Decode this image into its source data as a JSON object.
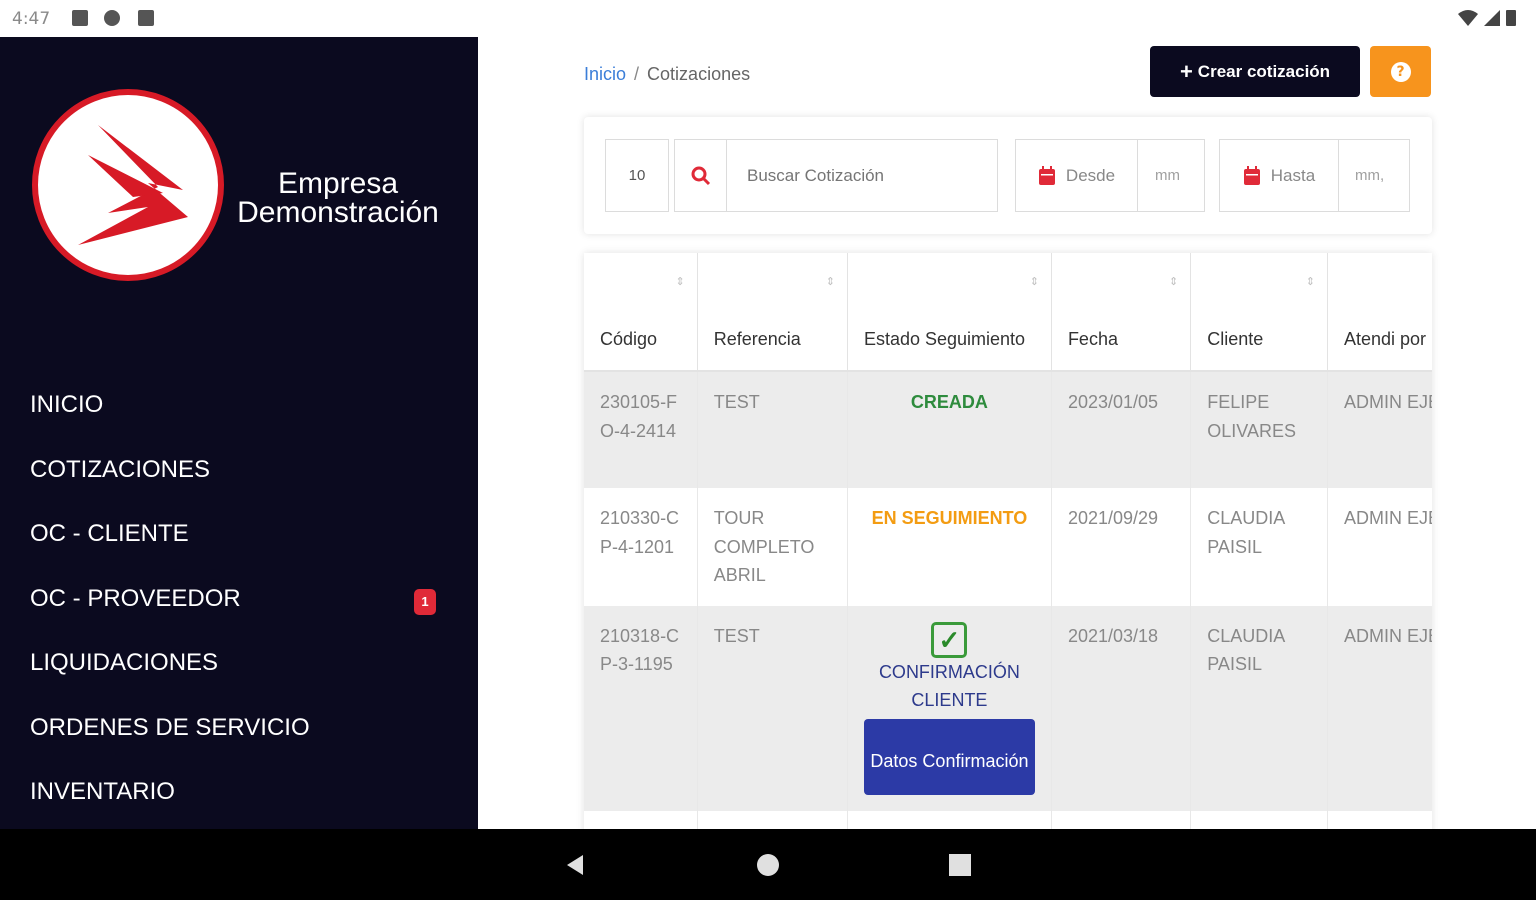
{
  "status_bar": {
    "time": "4:47"
  },
  "sidebar": {
    "brand_line1": "Empresa",
    "brand_line2": "Demonstración",
    "items": [
      {
        "label": "INICIO"
      },
      {
        "label": "COTIZACIONES"
      },
      {
        "label": "OC - CLIENTE"
      },
      {
        "label": "OC - PROVEEDOR",
        "badge": "1"
      },
      {
        "label": "LIQUIDACIONES"
      },
      {
        "label": "ORDENES DE SERVICIO"
      },
      {
        "label": "INVENTARIO"
      }
    ]
  },
  "header": {
    "breadcrumb_home": "Inicio",
    "breadcrumb_sep": "/",
    "breadcrumb_current": "Cotizaciones",
    "create_button": "Crear cotización",
    "help_button": "?"
  },
  "filters": {
    "page_size": "10",
    "search_placeholder": "Buscar Cotización",
    "from_label": "Desde",
    "from_value": "mm",
    "to_label": "Hasta",
    "to_value": "mm,"
  },
  "table": {
    "headers": [
      "Código",
      "Referencia",
      "Estado Seguimiento",
      "Fecha",
      "Cliente",
      "Atendi por"
    ],
    "rows": [
      {
        "codigo": "230105-FO-4-2414",
        "referencia": "TEST",
        "estado": "CREADA",
        "fecha": "2023/01/05",
        "cliente": "FELIPE OLIVARES",
        "atendido": "ADMIN EJEMP"
      },
      {
        "codigo": "210330-CP-4-1201",
        "referencia": "TOUR COMPLETO ABRIL",
        "estado": "EN SEGUIMIENTO",
        "fecha": "2021/09/29",
        "cliente": "CLAUDIA PAISIL",
        "atendido": "ADMIN EJEMP"
      },
      {
        "codigo": "210318-CP-3-1195",
        "referencia": "TEST",
        "estado": "CONFIRMACIÓN CLIENTE",
        "estado_button": "Datos Confirmación",
        "fecha": "2021/03/18",
        "cliente": "CLAUDIA PAISIL",
        "atendido": "ADMIN EJEMP"
      }
    ]
  },
  "colors": {
    "sidebar_bg": "#0b0a1f",
    "accent_orange": "#f7941d",
    "status_green": "#2e8b3d",
    "status_orange": "#f39c12",
    "confirm_blue": "#2c3aa6",
    "logo_red": "#d71a26"
  },
  "icons": [
    "search-icon",
    "calendar-icon",
    "help-icon",
    "plus-icon",
    "back-icon",
    "home-icon",
    "recents-icon",
    "wifi-icon",
    "signal-icon",
    "battery-icon"
  ]
}
